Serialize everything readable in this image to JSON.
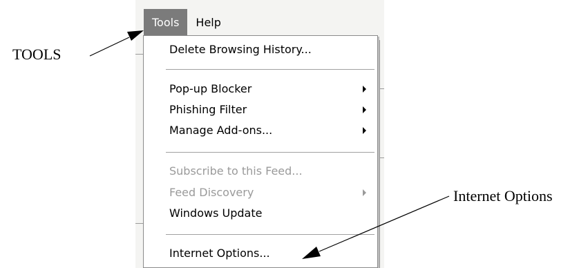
{
  "menubar": {
    "items": [
      {
        "label": "Tools",
        "active": true
      },
      {
        "label": "Help",
        "active": false
      }
    ]
  },
  "tools_menu": {
    "items": [
      {
        "label": "Delete Browsing History...",
        "enabled": true,
        "submenu": false
      },
      {
        "label": "Pop-up Blocker",
        "enabled": true,
        "submenu": true
      },
      {
        "label": "Phishing Filter",
        "enabled": true,
        "submenu": true
      },
      {
        "label": "Manage Add-ons...",
        "enabled": true,
        "submenu": true
      },
      {
        "label": "Subscribe to this Feed...",
        "enabled": false,
        "submenu": false
      },
      {
        "label": "Feed Discovery",
        "enabled": false,
        "submenu": true
      },
      {
        "label": "Windows Update",
        "enabled": true,
        "submenu": false
      },
      {
        "label": "Internet Options...",
        "enabled": true,
        "submenu": false
      }
    ]
  },
  "annotations": {
    "tools_label": "TOOLS",
    "internet_options_label": "Internet Options"
  },
  "colors": {
    "active_menu_bg": "#7b7b7b",
    "disabled_text": "#9a9a9a"
  }
}
